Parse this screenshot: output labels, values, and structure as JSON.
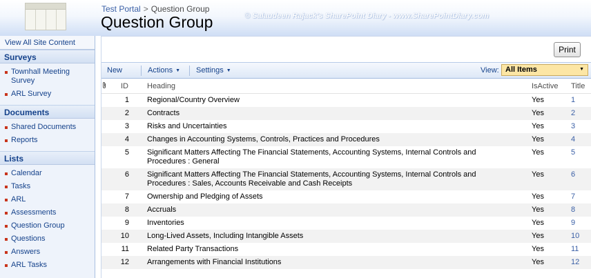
{
  "header": {
    "breadcrumb": [
      {
        "label": "Test Portal"
      },
      {
        "label": "Question Group"
      }
    ],
    "breadcrumb_separator": ">",
    "title": "Question Group",
    "watermark": "© Salaudeen Rajack's SharePoint Diary - www.SharePointDiary.com"
  },
  "leftnav": {
    "view_all": "View All Site Content",
    "sections": [
      {
        "heading": "Surveys",
        "items": [
          {
            "label": "Townhall Meeting Survey"
          },
          {
            "label": "ARL Survey"
          }
        ]
      },
      {
        "heading": "Documents",
        "items": [
          {
            "label": "Shared Documents"
          },
          {
            "label": "Reports"
          }
        ]
      },
      {
        "heading": "Lists",
        "items": [
          {
            "label": "Calendar"
          },
          {
            "label": "Tasks"
          },
          {
            "label": "ARL"
          },
          {
            "label": "Assessments"
          },
          {
            "label": "Question Group"
          },
          {
            "label": "Questions"
          },
          {
            "label": "Answers"
          },
          {
            "label": "ARL Tasks"
          }
        ]
      }
    ]
  },
  "main": {
    "print_label": "Print",
    "toolbar": {
      "new_label": "New",
      "actions_label": "Actions",
      "settings_label": "Settings",
      "view_label": "View:",
      "view_value": "All Items"
    },
    "table": {
      "headers": {
        "attachment_icon": "paperclip-icon",
        "id": "ID",
        "heading": "Heading",
        "isactive": "IsActive",
        "title": "Title"
      },
      "rows": [
        {
          "id": "1",
          "heading": "Regional/Country Overview",
          "isactive": "Yes",
          "title": "1"
        },
        {
          "id": "2",
          "heading": "Contracts",
          "isactive": "Yes",
          "title": "2"
        },
        {
          "id": "3",
          "heading": "Risks and Uncertainties",
          "isactive": "Yes",
          "title": "3"
        },
        {
          "id": "4",
          "heading": "Changes in Accounting Systems, Controls, Practices and Procedures",
          "isactive": "Yes",
          "title": "4"
        },
        {
          "id": "5",
          "heading": "Significant Matters Affecting The Financial Statements, Accounting Systems, Internal Controls and Procedures : General",
          "isactive": "Yes",
          "title": "5"
        },
        {
          "id": "6",
          "heading": "Significant Matters Affecting The Financial Statements, Accounting Systems, Internal Controls and Procedures  : Sales, Accounts Receivable and Cash Receipts",
          "isactive": "Yes",
          "title": "6"
        },
        {
          "id": "7",
          "heading": "Ownership and Pledging of Assets",
          "isactive": "Yes",
          "title": "7"
        },
        {
          "id": "8",
          "heading": "Accruals",
          "isactive": "Yes",
          "title": "8"
        },
        {
          "id": "9",
          "heading": "Inventories",
          "isactive": "Yes",
          "title": "9"
        },
        {
          "id": "10",
          "heading": "Long-Lived Assets, Including Intangible Assets",
          "isactive": "Yes",
          "title": "10"
        },
        {
          "id": "11",
          "heading": "Related Party Transactions",
          "isactive": "Yes",
          "title": "11"
        },
        {
          "id": "12",
          "heading": "Arrangements with Financial Institutions",
          "isactive": "Yes",
          "title": "12"
        }
      ]
    }
  },
  "colors": {
    "link": "#15428b",
    "accent_bullet": "#c8341c",
    "view_highlight": "#fce6a5"
  }
}
